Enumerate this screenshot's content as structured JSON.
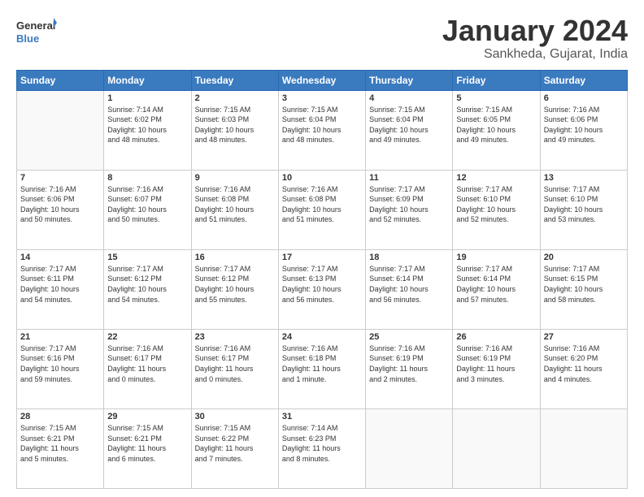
{
  "logo": {
    "line1": "General",
    "line2": "Blue"
  },
  "title": "January 2024",
  "subtitle": "Sankheda, Gujarat, India",
  "headers": [
    "Sunday",
    "Monday",
    "Tuesday",
    "Wednesday",
    "Thursday",
    "Friday",
    "Saturday"
  ],
  "weeks": [
    [
      {
        "day": "",
        "info": ""
      },
      {
        "day": "1",
        "info": "Sunrise: 7:14 AM\nSunset: 6:02 PM\nDaylight: 10 hours\nand 48 minutes."
      },
      {
        "day": "2",
        "info": "Sunrise: 7:15 AM\nSunset: 6:03 PM\nDaylight: 10 hours\nand 48 minutes."
      },
      {
        "day": "3",
        "info": "Sunrise: 7:15 AM\nSunset: 6:04 PM\nDaylight: 10 hours\nand 48 minutes."
      },
      {
        "day": "4",
        "info": "Sunrise: 7:15 AM\nSunset: 6:04 PM\nDaylight: 10 hours\nand 49 minutes."
      },
      {
        "day": "5",
        "info": "Sunrise: 7:15 AM\nSunset: 6:05 PM\nDaylight: 10 hours\nand 49 minutes."
      },
      {
        "day": "6",
        "info": "Sunrise: 7:16 AM\nSunset: 6:06 PM\nDaylight: 10 hours\nand 49 minutes."
      }
    ],
    [
      {
        "day": "7",
        "info": "Sunrise: 7:16 AM\nSunset: 6:06 PM\nDaylight: 10 hours\nand 50 minutes."
      },
      {
        "day": "8",
        "info": "Sunrise: 7:16 AM\nSunset: 6:07 PM\nDaylight: 10 hours\nand 50 minutes."
      },
      {
        "day": "9",
        "info": "Sunrise: 7:16 AM\nSunset: 6:08 PM\nDaylight: 10 hours\nand 51 minutes."
      },
      {
        "day": "10",
        "info": "Sunrise: 7:16 AM\nSunset: 6:08 PM\nDaylight: 10 hours\nand 51 minutes."
      },
      {
        "day": "11",
        "info": "Sunrise: 7:17 AM\nSunset: 6:09 PM\nDaylight: 10 hours\nand 52 minutes."
      },
      {
        "day": "12",
        "info": "Sunrise: 7:17 AM\nSunset: 6:10 PM\nDaylight: 10 hours\nand 52 minutes."
      },
      {
        "day": "13",
        "info": "Sunrise: 7:17 AM\nSunset: 6:10 PM\nDaylight: 10 hours\nand 53 minutes."
      }
    ],
    [
      {
        "day": "14",
        "info": "Sunrise: 7:17 AM\nSunset: 6:11 PM\nDaylight: 10 hours\nand 54 minutes."
      },
      {
        "day": "15",
        "info": "Sunrise: 7:17 AM\nSunset: 6:12 PM\nDaylight: 10 hours\nand 54 minutes."
      },
      {
        "day": "16",
        "info": "Sunrise: 7:17 AM\nSunset: 6:12 PM\nDaylight: 10 hours\nand 55 minutes."
      },
      {
        "day": "17",
        "info": "Sunrise: 7:17 AM\nSunset: 6:13 PM\nDaylight: 10 hours\nand 56 minutes."
      },
      {
        "day": "18",
        "info": "Sunrise: 7:17 AM\nSunset: 6:14 PM\nDaylight: 10 hours\nand 56 minutes."
      },
      {
        "day": "19",
        "info": "Sunrise: 7:17 AM\nSunset: 6:14 PM\nDaylight: 10 hours\nand 57 minutes."
      },
      {
        "day": "20",
        "info": "Sunrise: 7:17 AM\nSunset: 6:15 PM\nDaylight: 10 hours\nand 58 minutes."
      }
    ],
    [
      {
        "day": "21",
        "info": "Sunrise: 7:17 AM\nSunset: 6:16 PM\nDaylight: 10 hours\nand 59 minutes."
      },
      {
        "day": "22",
        "info": "Sunrise: 7:16 AM\nSunset: 6:17 PM\nDaylight: 11 hours\nand 0 minutes."
      },
      {
        "day": "23",
        "info": "Sunrise: 7:16 AM\nSunset: 6:17 PM\nDaylight: 11 hours\nand 0 minutes."
      },
      {
        "day": "24",
        "info": "Sunrise: 7:16 AM\nSunset: 6:18 PM\nDaylight: 11 hours\nand 1 minute."
      },
      {
        "day": "25",
        "info": "Sunrise: 7:16 AM\nSunset: 6:19 PM\nDaylight: 11 hours\nand 2 minutes."
      },
      {
        "day": "26",
        "info": "Sunrise: 7:16 AM\nSunset: 6:19 PM\nDaylight: 11 hours\nand 3 minutes."
      },
      {
        "day": "27",
        "info": "Sunrise: 7:16 AM\nSunset: 6:20 PM\nDaylight: 11 hours\nand 4 minutes."
      }
    ],
    [
      {
        "day": "28",
        "info": "Sunrise: 7:15 AM\nSunset: 6:21 PM\nDaylight: 11 hours\nand 5 minutes."
      },
      {
        "day": "29",
        "info": "Sunrise: 7:15 AM\nSunset: 6:21 PM\nDaylight: 11 hours\nand 6 minutes."
      },
      {
        "day": "30",
        "info": "Sunrise: 7:15 AM\nSunset: 6:22 PM\nDaylight: 11 hours\nand 7 minutes."
      },
      {
        "day": "31",
        "info": "Sunrise: 7:14 AM\nSunset: 6:23 PM\nDaylight: 11 hours\nand 8 minutes."
      },
      {
        "day": "",
        "info": ""
      },
      {
        "day": "",
        "info": ""
      },
      {
        "day": "",
        "info": ""
      }
    ]
  ]
}
